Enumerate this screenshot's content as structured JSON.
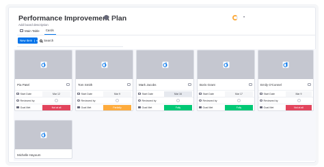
{
  "board": {
    "title": "Performance Improvement Plan",
    "subtitle": "Add board description",
    "tabs": [
      {
        "label": "Main Table"
      },
      {
        "label": "Cards"
      }
    ]
  },
  "toolbar": {
    "new_item_label": "New Item",
    "search_label": "Search"
  },
  "columns": {
    "start_date": "Start Date",
    "reviewed_by": "Reviewed by",
    "goal_met": "Goal Met"
  },
  "cards": [
    {
      "name": "Pia Patel",
      "start_date": "Mar 12",
      "goal_met": "Not at all",
      "goal_color": "#e2445c"
    },
    {
      "name": "Tom Smith",
      "start_date": "Mar 9",
      "goal_met": "Partially",
      "goal_color": "#fdab3d"
    },
    {
      "name": "Mark Jacobs",
      "start_date": "Mar 16",
      "goal_met": "Fully",
      "goal_color": "#00c875"
    },
    {
      "name": "Boris Grant",
      "start_date": "Mar 17",
      "goal_met": "Fully",
      "goal_color": "#00c875"
    },
    {
      "name": "Emily O'Connel",
      "start_date": "Mar 9",
      "goal_met": "Not at all",
      "goal_color": "#e2445c"
    },
    {
      "name": "Michelle Hayoum"
    }
  ],
  "colors": {
    "accent": "#0073ea",
    "not_at_all": "#e2445c",
    "partially": "#fdab3d",
    "fully": "#00c875",
    "thumb": "#c5c7d0"
  }
}
